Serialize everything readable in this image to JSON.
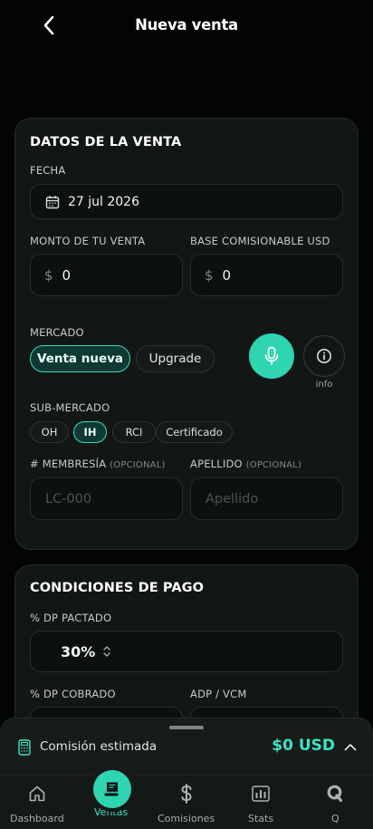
{
  "header": {
    "title": "Nueva venta",
    "back_icon": "chevron-left-icon"
  },
  "sale": {
    "title": "DATOS DE LA VENTA",
    "date_label": "FECHA",
    "date_value": "27 jul 2026",
    "amount_label": "MONTO DE TU VENTA",
    "amount_currency": "$",
    "amount_value": "0",
    "base_label": "BASE COMISIONABLE USD",
    "base_currency": "$",
    "base_value": "0",
    "market_label": "MERCADO",
    "market_options": [
      "Venta nueva",
      "Upgrade"
    ],
    "market_selected": "Venta nueva",
    "info_label": "info",
    "submarket_label": "SUB-MERCADO",
    "submarket_options": [
      "OH",
      "IH",
      "RCI",
      "Certificado"
    ],
    "submarket_selected": "IH",
    "membership_label": "# MEMBRESÍA",
    "membership_optional": "(OPCIONAL)",
    "membership_placeholder": "LC-000",
    "surname_label": "APELLIDO",
    "surname_optional": "(OPCIONAL)",
    "surname_placeholder": "Apellido"
  },
  "payment": {
    "title": "CONDICIONES DE PAGO",
    "dp_agreed_label": "% DP PACTADO",
    "dp_agreed_value": "30%",
    "dp_collected_label": "% DP COBRADO",
    "adp_label": "ADP / VCM"
  },
  "commission": {
    "label": "Comisión estimada",
    "value": "$0 USD"
  },
  "tabs": [
    {
      "label": "Dashboard",
      "icon": "home-icon"
    },
    {
      "label": "Ventas",
      "icon": "receipt-icon",
      "active": true
    },
    {
      "label": "Comisiones",
      "icon": "dollar-icon"
    },
    {
      "label": "Stats",
      "icon": "bar-chart-icon"
    },
    {
      "label": "Q",
      "icon": "q-icon"
    }
  ],
  "colors": {
    "accent": "#2fd4b1",
    "background": "#030404",
    "card": "#121716"
  }
}
